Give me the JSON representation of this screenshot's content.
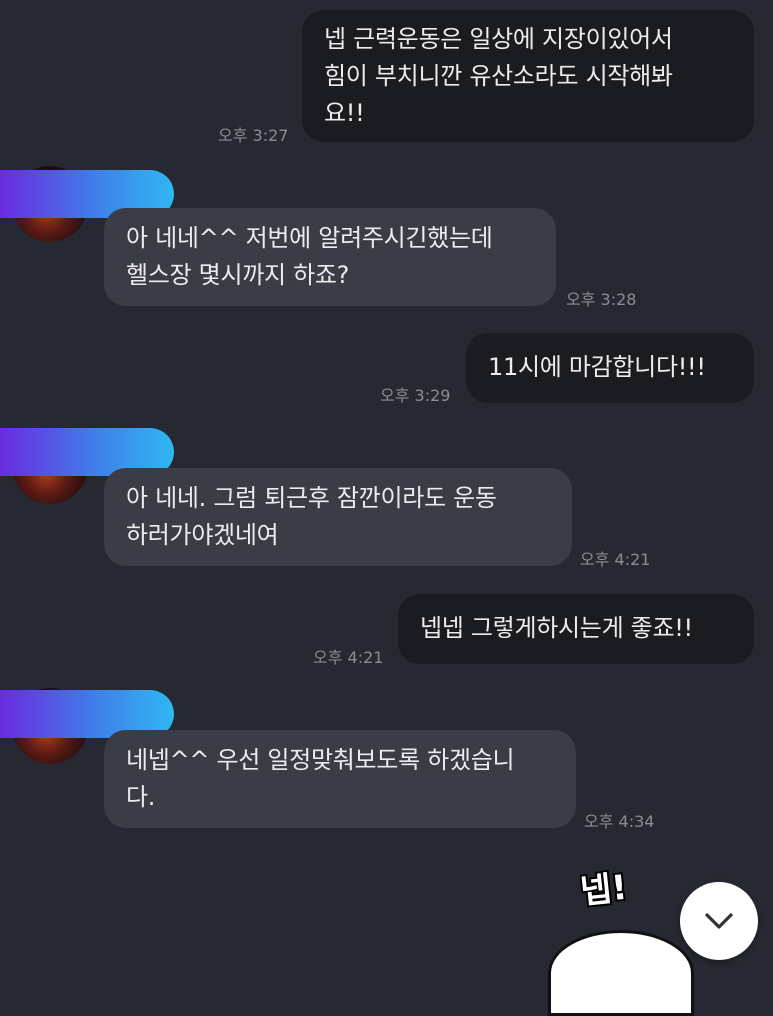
{
  "messages": [
    {
      "text": "넵 근력운동은 일상에 지장이있어서\n힘이 부치니깐 유산소라도 시작해봐\n요!!",
      "time": "오후 3:27"
    },
    {
      "text": "아 네네^^ 저번에 알려주시긴했는데\n헬스장 몇시까지 하죠?",
      "time": "오후 3:28"
    },
    {
      "text": "11시에 마감합니다!!!",
      "time": "오후 3:29"
    },
    {
      "text": "아 네네. 그럼 퇴근후 잠깐이라도 운동\n하러가야겠네여",
      "time": "오후 4:21"
    },
    {
      "text": "넵넵 그렇게하시는게 좋죠!!",
      "time": "오후 4:21"
    },
    {
      "text": "네넵^^ 우선 일정맞춰보도록 하겠습니\n다.",
      "time": "오후 4:34"
    }
  ],
  "sticker": {
    "text": "넵!"
  },
  "icons": {
    "scroll_down": "chevron-down-icon"
  },
  "colors": {
    "background": "#262931",
    "outgoing_bubble": "#1b1c21",
    "incoming_bubble": "#3a3d46",
    "name_bar_gradient": [
      "#6b2be0",
      "#3f7fea",
      "#2fb7f2"
    ]
  }
}
